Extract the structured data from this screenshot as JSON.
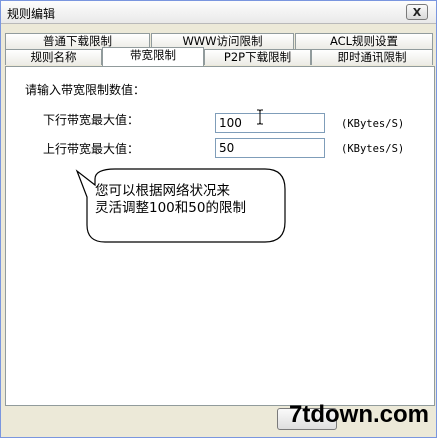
{
  "window": {
    "title": "规则编辑",
    "close_label": "X"
  },
  "tabs_row1": [
    {
      "label": "普通下载限制"
    },
    {
      "label": "WWW访问限制"
    },
    {
      "label": "ACL规则设置"
    }
  ],
  "tabs_row2": [
    {
      "label": "规则名称"
    },
    {
      "label": "带宽限制"
    },
    {
      "label": "P2P下载限制"
    },
    {
      "label": "即时通讯限制"
    }
  ],
  "active_tab": "带宽限制",
  "panel": {
    "prompt": "请输入带宽限制数值：",
    "downlink_label": "下行带宽最大值：",
    "downlink_value": "100",
    "downlink_unit": "(KBytes/S)",
    "uplink_label": "上行带宽最大值：",
    "uplink_value": "50",
    "uplink_unit": "(KBytes/S)"
  },
  "callout": {
    "line1": "您可以根据网络状况来",
    "line2": "灵活调整100和50的限制"
  },
  "watermark": "7tdown.com"
}
